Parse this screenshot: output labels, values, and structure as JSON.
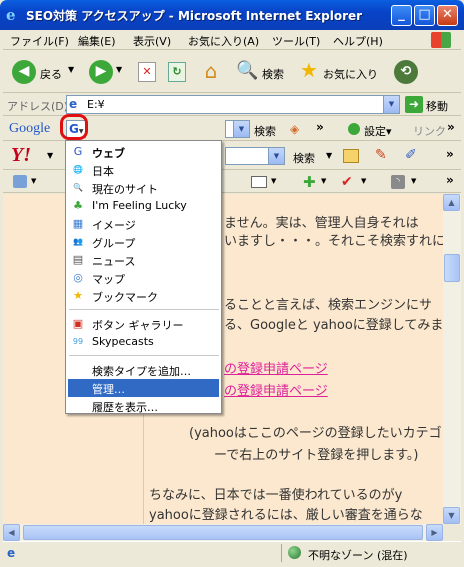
{
  "window": {
    "title": "SEO対策 アクセスアップ - Microsoft Internet Explorer",
    "controls": {
      "minimize": "_",
      "maximize": "□",
      "close": "✕"
    }
  },
  "menubar": {
    "items": [
      "ファイル(F)",
      "編集(E)",
      "表示(V)",
      "お気に入り(A)",
      "ツール(T)",
      "ヘルプ(H)"
    ]
  },
  "toolbar": {
    "back_label": "戻る",
    "search_label": "検索",
    "favorites_label": "お気に入り"
  },
  "addressbar": {
    "label": "アドレス(D)",
    "value": "E:¥",
    "go_label": "移動"
  },
  "google_toolbar": {
    "logo": "Google",
    "search_label": "検索",
    "settings_label": "設定▾",
    "link_label": "リンク"
  },
  "yahoo_toolbar": {
    "logo": "Y!",
    "search_label": "検索"
  },
  "dropdown": {
    "groups": [
      [
        {
          "icon": "G",
          "label": "ウェブ",
          "bold": true
        },
        {
          "icon": "🌐",
          "label": "日本"
        },
        {
          "icon": "🔍",
          "label": "現在のサイト"
        },
        {
          "icon": "♣",
          "label": "I'm Feeling Lucky"
        },
        {
          "icon": "▦",
          "label": "イメージ"
        },
        {
          "icon": "👥",
          "label": "グループ"
        },
        {
          "icon": "▤",
          "label": "ニュース"
        },
        {
          "icon": "◎",
          "label": "マップ"
        },
        {
          "icon": "★",
          "label": "ブックマーク"
        }
      ],
      [
        {
          "icon": "▣",
          "label": "ボタン ギャラリー"
        },
        {
          "icon": "99",
          "label": "Skypecasts"
        }
      ],
      [
        {
          "icon": "",
          "label": "検索タイプを追加…"
        },
        {
          "icon": "",
          "label": "管理…",
          "selected": true
        },
        {
          "icon": "",
          "label": "履歴を表示…"
        }
      ]
    ]
  },
  "page": {
    "lines": [
      "ません。実は、管理人自身それは",
      "いますし・・・。それこそ検索すれに",
      "ることと言えば、検索エンジンにサ",
      "る、Googleと yahooに登録してみま",
      "の登録申請ページ",
      "の登録申請ページ",
      "(yahooはここのページの登録したいカテゴリー",
      "ーで右上のサイト登録を押します。)",
      "ちなみに、日本では一番使われているのがy",
      "yahooに登録されるには、厳しい審査を通らな"
    ]
  },
  "statusbar": {
    "zone": "不明なゾーン (混在)"
  },
  "colors": {
    "title_blue": "#0a5fe0",
    "page_bg": "#fbe8cf",
    "link_pink": "#e0209a",
    "selected_bg": "#316ac5",
    "highlight_red": "#e01010"
  }
}
